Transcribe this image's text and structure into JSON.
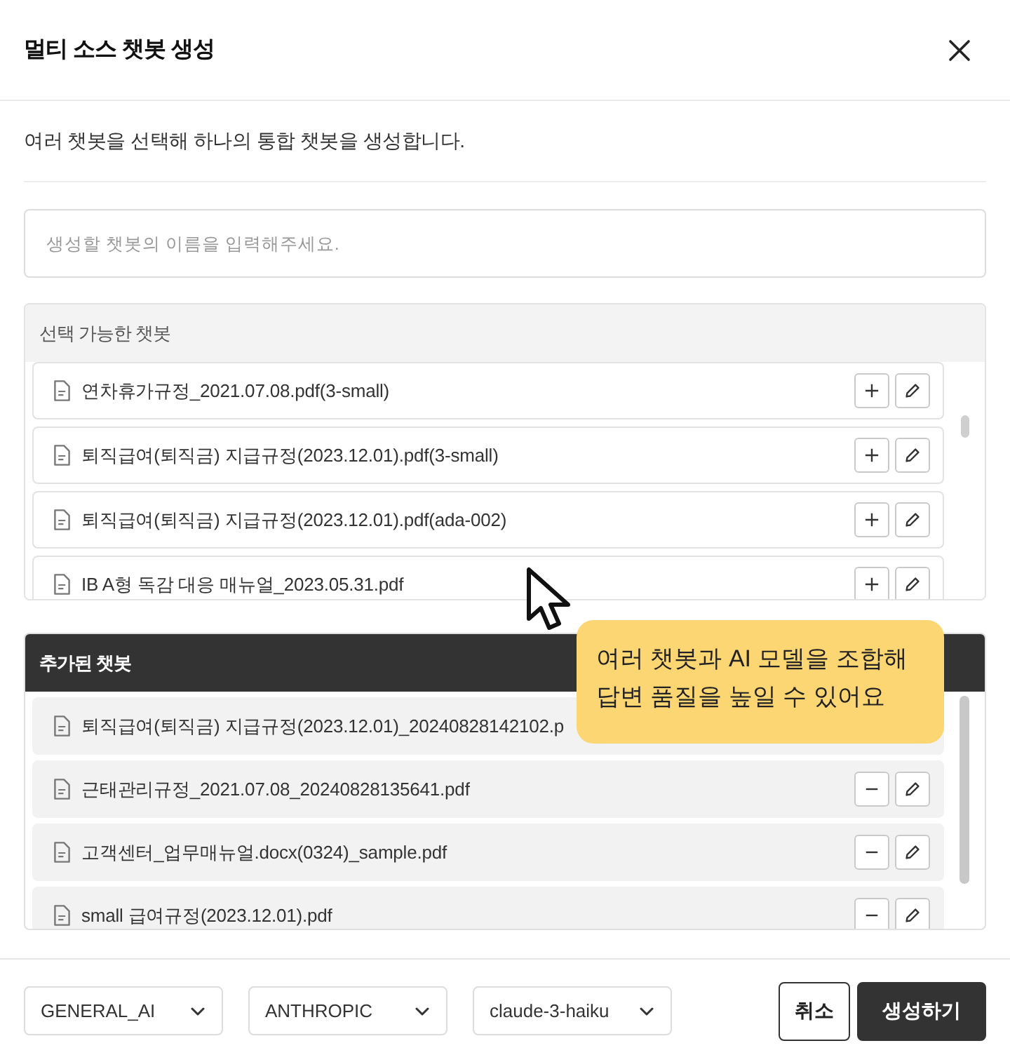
{
  "dialog": {
    "title": "멀티 소스 챗봇 생성",
    "description": "여러 챗봇을 선택해 하나의 통합 챗봇을 생성합니다."
  },
  "name_field": {
    "placeholder": "생성할 챗봇의 이름을 입력해주세요."
  },
  "available_chatbots": {
    "title": "선택 가능한 챗봇",
    "items": [
      {
        "name": "연차휴가규정_2021.07.08.pdf(3-small)",
        "kind": "addable"
      },
      {
        "name": "퇴직급여(퇴직금) 지급규정(2023.12.01).pdf(3-small)",
        "kind": "addable"
      },
      {
        "name": "퇴직급여(퇴직금) 지급규정(2023.12.01).pdf(ada-002)",
        "kind": "addable"
      },
      {
        "name": "IB A형 독감 대응 매뉴얼_2023.05.31.pdf",
        "kind": "addable"
      }
    ]
  },
  "added_chatbots": {
    "title": "추가된 챗봇",
    "items": [
      {
        "name": "퇴직급여(퇴직금) 지급규정(2023.12.01)_20240828142102.p",
        "kind": "plain"
      },
      {
        "name": "근태관리규정_2021.07.08_20240828135641.pdf",
        "kind": "removable"
      },
      {
        "name": "고객센터_업무매뉴얼.docx(0324)_sample.pdf",
        "kind": "removable"
      },
      {
        "name": "small 급여규정(2023.12.01).pdf",
        "kind": "removable"
      }
    ]
  },
  "tooltip": {
    "text": "여러 챗봇과 AI 모델을 조합해 답변 품질을 높일 수 있어요"
  },
  "footer": {
    "selects": [
      {
        "value": "GENERAL_AI"
      },
      {
        "value": "ANTHROPIC"
      },
      {
        "value": "claude-3-haiku"
      }
    ],
    "buttons": [
      {
        "label": "취소",
        "kind": "secondary"
      },
      {
        "label": "생성하기",
        "kind": "primary"
      }
    ]
  }
}
